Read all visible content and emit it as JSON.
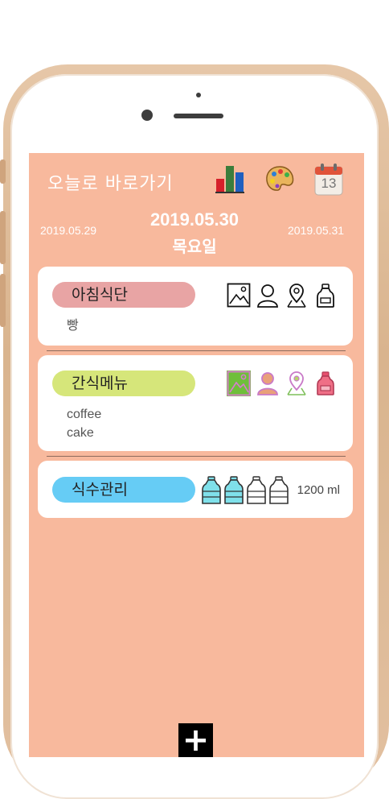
{
  "header": {
    "title": "오늘로 바로가기",
    "icons": [
      "bar-chart-icon",
      "palette-icon",
      "calendar-icon"
    ],
    "calendar_day": "13"
  },
  "dates": {
    "prev": "2019.05.29",
    "current": "2019.05.30",
    "weekday": "목요일",
    "next": "2019.05.31"
  },
  "breakfast": {
    "label": "아침식단",
    "items": [
      "빵"
    ],
    "color": "#e8a4a4",
    "icons": [
      "image-icon",
      "person-icon",
      "location-icon",
      "bottle-icon"
    ]
  },
  "snack": {
    "label": "간식메뉴",
    "items": [
      "coffee",
      "cake"
    ],
    "color": "#d6e67a",
    "icons": [
      "image-icon",
      "person-icon",
      "location-icon",
      "bottle-icon"
    ]
  },
  "water": {
    "label": "식수관리",
    "amount": "1200 ml",
    "color": "#66ccf5",
    "filled_bottles": 2,
    "total_bottles": 4
  },
  "add_button": {
    "label": "+"
  },
  "colors": {
    "screen_bg": "#f8b99d",
    "frame": "#d9b48e"
  }
}
